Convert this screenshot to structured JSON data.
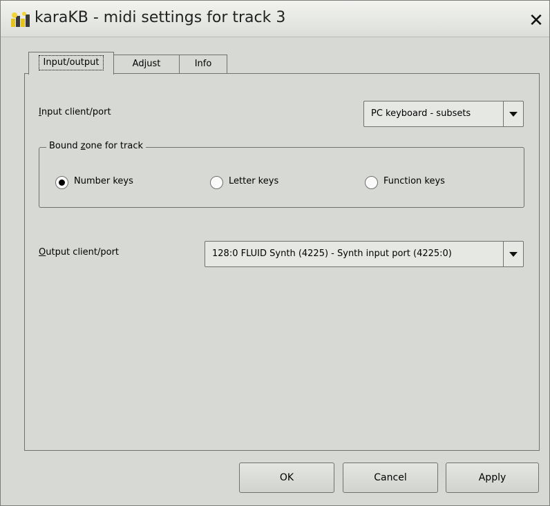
{
  "window": {
    "title": "karaKB - midi settings for track 3",
    "close_glyph": "✕"
  },
  "tabs": [
    {
      "label": "Input/output"
    },
    {
      "label": "Adjust"
    },
    {
      "label": "Info"
    }
  ],
  "input": {
    "label_key": "I",
    "label_rest": "nput client/port",
    "selected": "PC keyboard - subsets"
  },
  "bound_zone": {
    "title_prefix": "Bound ",
    "title_key": "z",
    "title_rest": "one for track",
    "options": [
      {
        "label": "Number keys",
        "checked": true
      },
      {
        "label": "Letter keys",
        "checked": false
      },
      {
        "label": "Function keys",
        "checked": false
      }
    ]
  },
  "output": {
    "label_key": "O",
    "label_rest": "utput client/port",
    "selected": "128:0 FLUID Synth (4225) - Synth input port (4225:0)"
  },
  "buttons": {
    "ok": "OK",
    "cancel": "Cancel",
    "apply": "Apply"
  },
  "icons": {
    "app": "karakb-app-icon",
    "close": "close-icon",
    "dropdown": "chevron-down-icon"
  }
}
